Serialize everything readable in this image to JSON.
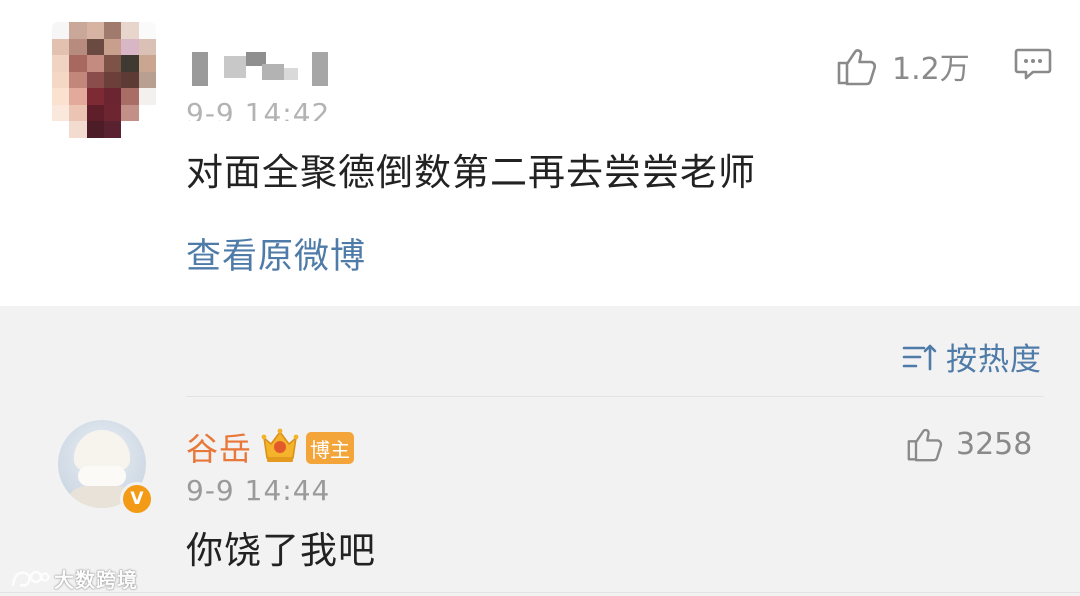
{
  "comment_top": {
    "timestamp": "9-9 14:42",
    "text": "对面全聚德倒数第二再去尝尝老师",
    "view_original_label": "查看原微博",
    "like_count": "1.2万"
  },
  "sort": {
    "label": "按热度"
  },
  "reply": {
    "author": "谷岳",
    "badge_label": "博主",
    "verified_mark": "V",
    "timestamp": "9-9 14:44",
    "text": "你饶了我吧",
    "like_count": "3258"
  },
  "watermark": {
    "text": "大数跨境"
  },
  "colors": {
    "link_blue": "#4f7ba8",
    "author_orange": "#e8773a",
    "badge_orange": "#f4a53a",
    "verified_orange": "#f39a16"
  }
}
